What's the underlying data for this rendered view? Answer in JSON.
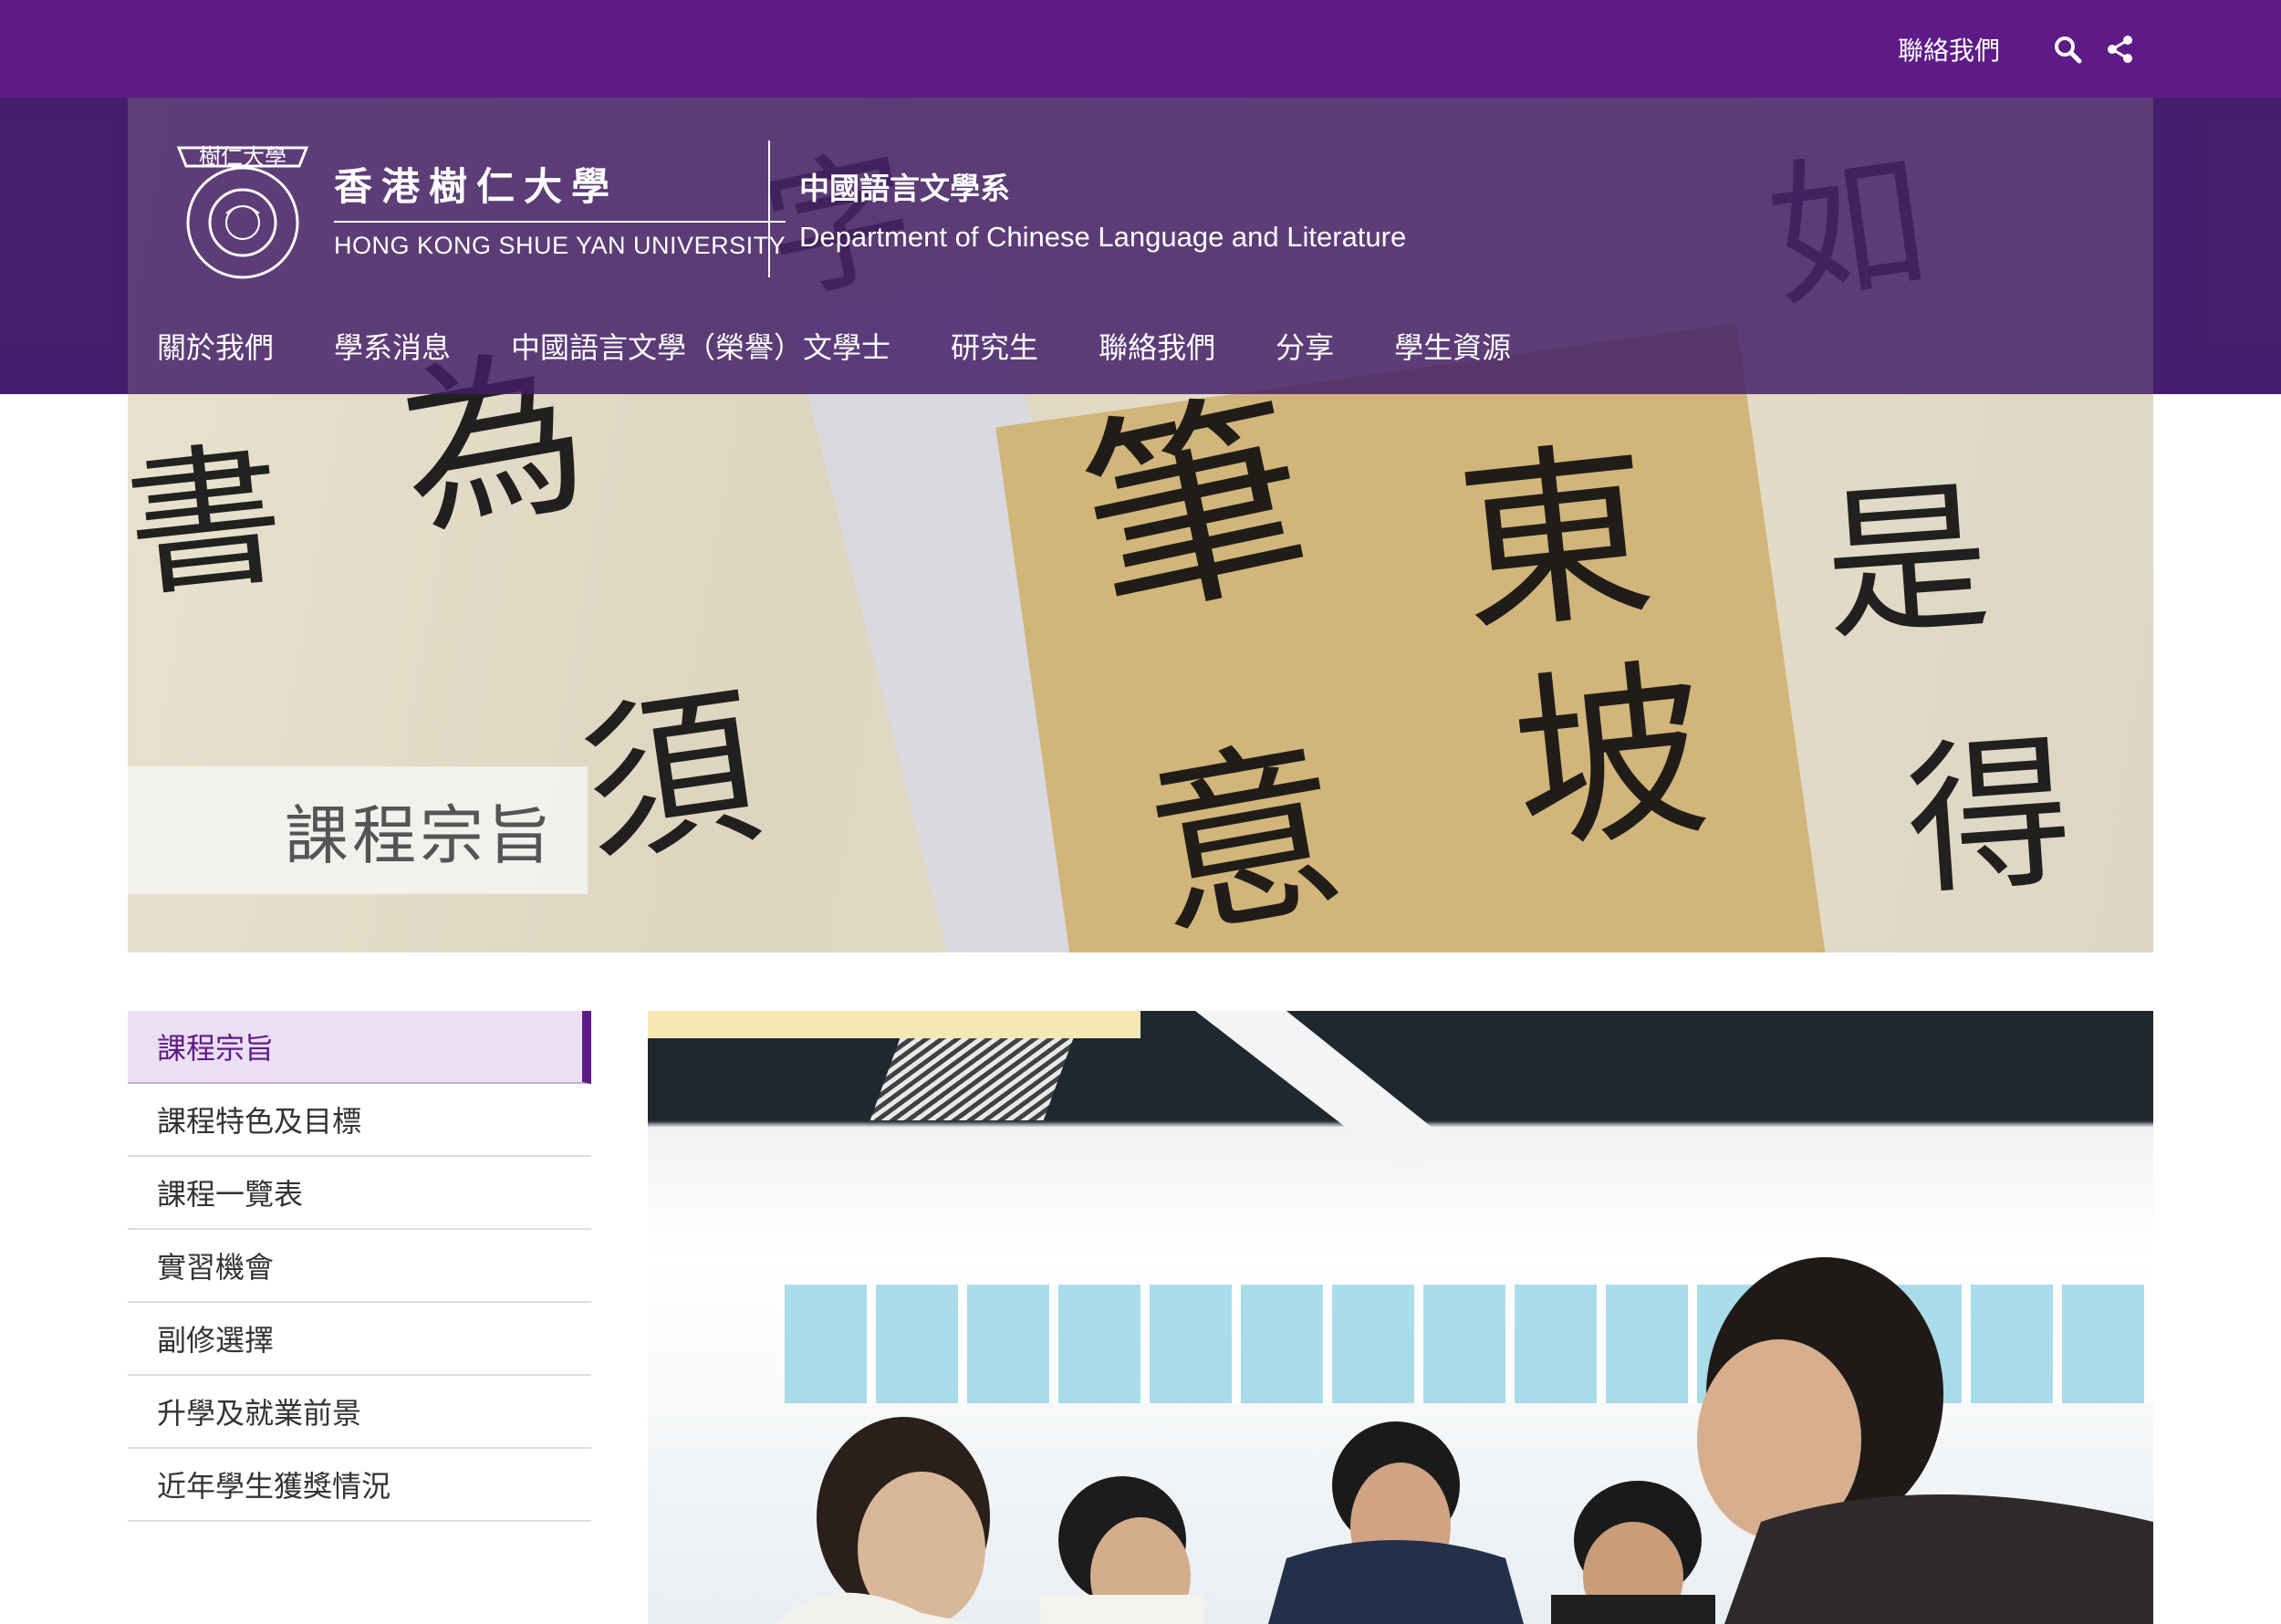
{
  "topbar": {
    "contact_label": "聯絡我們",
    "icons": [
      "search-icon",
      "share-icon"
    ],
    "bg_color": "#5e1b88"
  },
  "brand": {
    "seal_text": "樹仁大學",
    "university_zh": "香港樹仁大學",
    "university_en": "HONG KONG SHUE YAN UNIVERSITY",
    "department_zh": "中國語言文學系",
    "department_en": "Department of Chinese Language and Literature"
  },
  "nav": {
    "items": [
      {
        "label": "關於我們"
      },
      {
        "label": "學系消息"
      },
      {
        "label": "中國語言文學（榮譽）文學士"
      },
      {
        "label": "研究生"
      },
      {
        "label": "聯絡我們"
      },
      {
        "label": "分享"
      },
      {
        "label": "學生資源"
      }
    ]
  },
  "page": {
    "title": "課程宗旨"
  },
  "sidebar": {
    "active_index": 0,
    "items": [
      {
        "label": "課程宗旨"
      },
      {
        "label": "課程特色及目標"
      },
      {
        "label": "課程一覽表"
      },
      {
        "label": "實習機會"
      },
      {
        "label": "副修選擇"
      },
      {
        "label": "升學及就業前景"
      },
      {
        "label": "近年學生獲獎情況"
      }
    ]
  },
  "colors": {
    "brand_purple": "#5e1b88",
    "active_bg": "#ebdff2"
  }
}
